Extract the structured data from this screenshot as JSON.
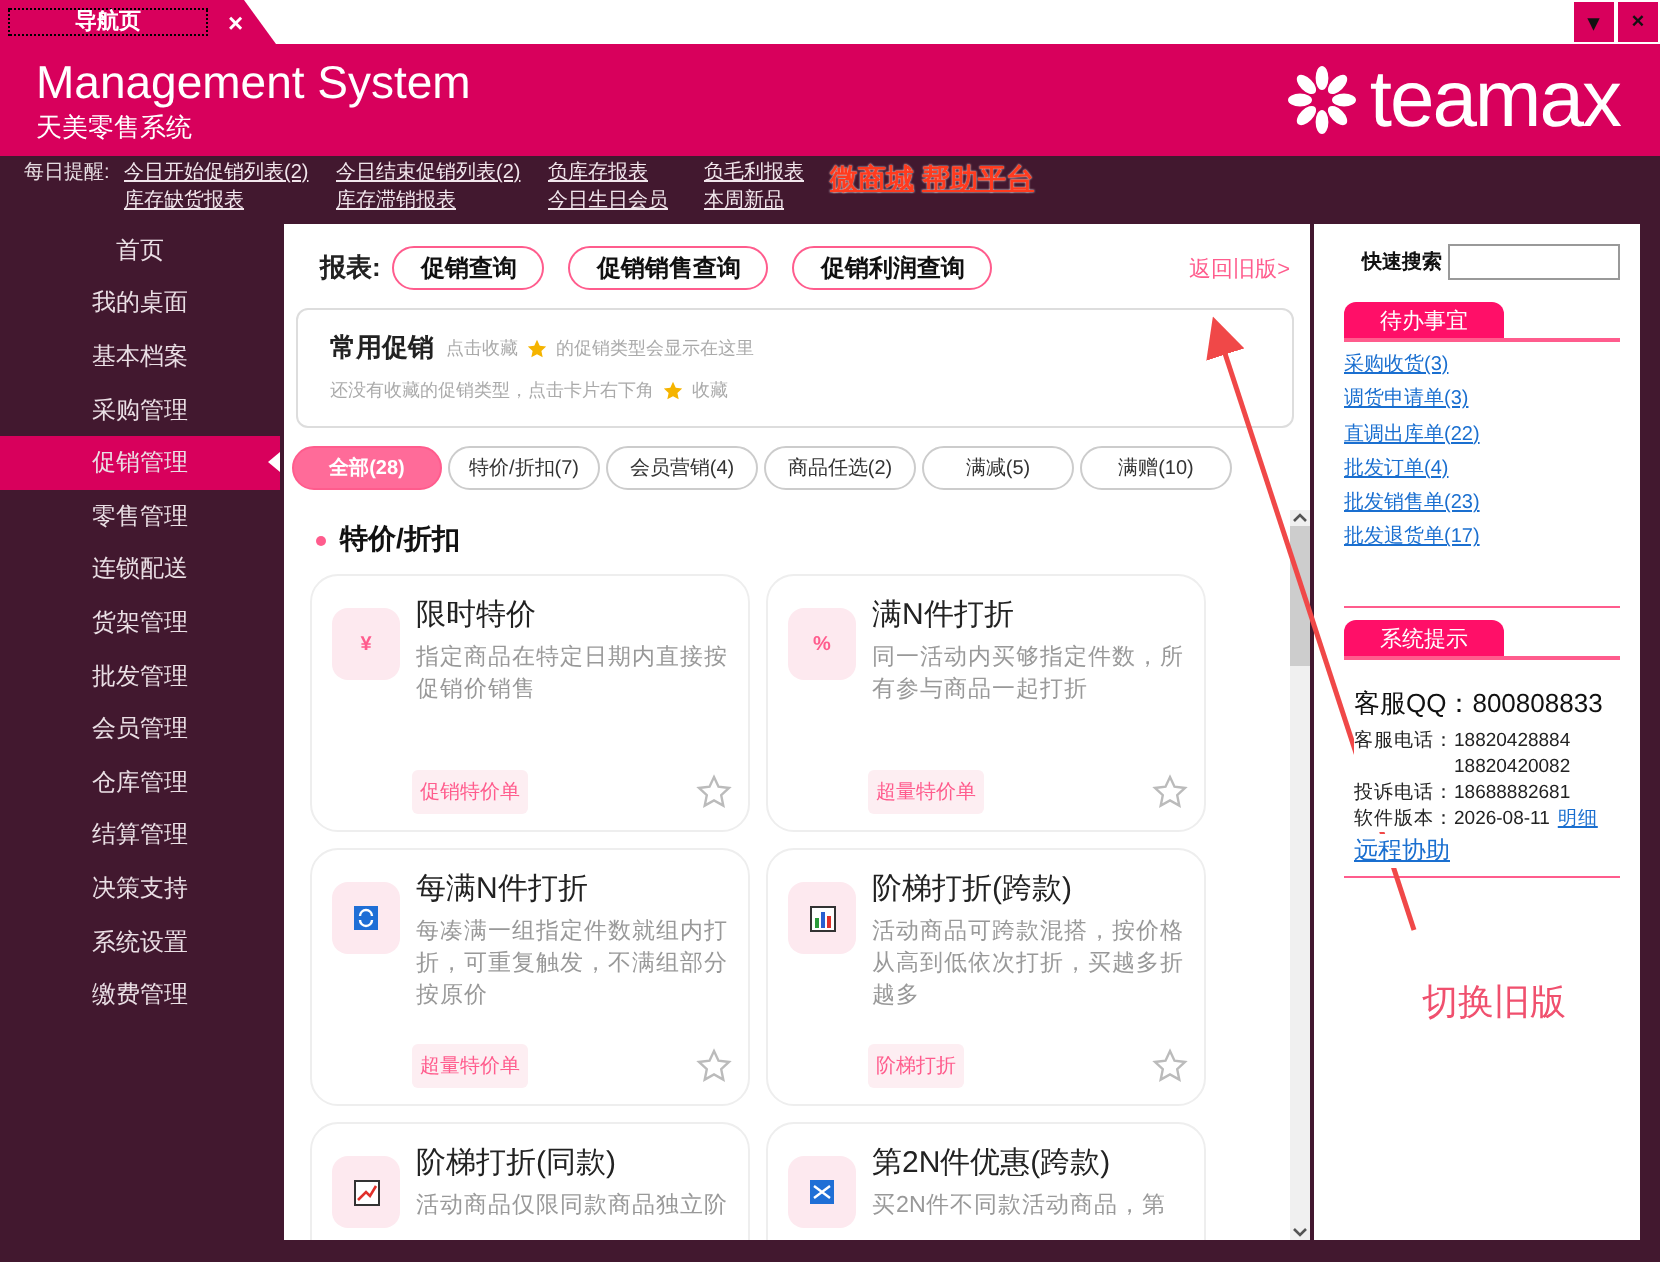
{
  "window": {
    "tab_title": "导航页",
    "tab_close": "×",
    "menu_button": "▾",
    "close_button": "×"
  },
  "header": {
    "title": "Management System",
    "subtitle": "天美零售系统",
    "logo_text": "teamax"
  },
  "reminders": {
    "label": "每日提醒:",
    "columns": [
      [
        "今日开始促销列表(2)",
        "库存缺货报表"
      ],
      [
        "今日结束促销列表(2)",
        "库存滞销报表"
      ],
      [
        "负库存报表",
        "今日生日会员"
      ],
      [
        "负毛利报表",
        "本周新品"
      ]
    ],
    "highlights": [
      "微商城",
      "帮助平台"
    ]
  },
  "sidebar": {
    "items": [
      {
        "label": "首页",
        "selected": false
      },
      {
        "label": "我的桌面",
        "selected": false
      },
      {
        "label": "基本档案",
        "selected": false
      },
      {
        "label": "采购管理",
        "selected": false
      },
      {
        "label": "促销管理",
        "selected": true
      },
      {
        "label": "零售管理",
        "selected": false
      },
      {
        "label": "连锁配送",
        "selected": false
      },
      {
        "label": "货架管理",
        "selected": false
      },
      {
        "label": "批发管理",
        "selected": false
      },
      {
        "label": "会员管理",
        "selected": false
      },
      {
        "label": "仓库管理",
        "selected": false
      },
      {
        "label": "结算管理",
        "selected": false
      },
      {
        "label": "决策支持",
        "selected": false
      },
      {
        "label": "系统设置",
        "selected": false
      },
      {
        "label": "缴费管理",
        "selected": false
      }
    ]
  },
  "reports": {
    "label": "报表:",
    "buttons": [
      "促销查询",
      "促销销售查询",
      "促销利润查询"
    ],
    "back_link": "返回旧版>"
  },
  "favorites": {
    "title": "常用促销",
    "hint_before": "点击收藏",
    "hint_after": "的促销类型会显示在这里",
    "empty_before": "还没有收藏的促销类型，点击卡片右下角",
    "empty_after": "收藏"
  },
  "filters": [
    {
      "label": "全部(28)",
      "selected": true
    },
    {
      "label": "特价/折扣(7)",
      "selected": false
    },
    {
      "label": "会员营销(4)",
      "selected": false
    },
    {
      "label": "商品任选(2)",
      "selected": false
    },
    {
      "label": "满减(5)",
      "selected": false
    },
    {
      "label": "满赠(10)",
      "selected": false
    }
  ],
  "section": {
    "title": "特价/折扣"
  },
  "cards": [
    {
      "icon": {
        "kind": "text",
        "text": "¥"
      },
      "title": "限时特价",
      "description": "指定商品在特定日期内直接按促销价销售",
      "tag": "促销特价单",
      "starred": false
    },
    {
      "icon": {
        "kind": "text",
        "text": "%"
      },
      "title": "满N件打折",
      "description": "同一活动内买够指定件数，所有参与商品一起打折",
      "tag": "超量特价单",
      "starred": false
    },
    {
      "icon": {
        "kind": "cycle"
      },
      "title": "每满N件打折",
      "description": "每凑满一组指定件数就组内打折，可重复触发，不满组部分按原价",
      "tag": "超量特价单",
      "starred": false
    },
    {
      "icon": {
        "kind": "bars"
      },
      "title": "阶梯打折(跨款)",
      "description": "活动商品可跨款混搭，按价格从高到低依次打折，买越多折越多",
      "tag": "阶梯打折",
      "starred": false
    },
    {
      "icon": {
        "kind": "trend"
      },
      "title": "阶梯打折(同款)",
      "description": "活动商品仅限同款商品独立阶"
    },
    {
      "icon": {
        "kind": "shuffle"
      },
      "title": "第2N件优惠(跨款)",
      "description": "买2N件不同款活动商品，第"
    }
  ],
  "todo": {
    "search_label": "快速搜索",
    "title": "待办事宜",
    "links": [
      "采购收货(3)",
      "调货申请单(3)",
      "直调出库单(22)",
      "批发订单(4)",
      "批发销售单(23)",
      "批发退货单(17)"
    ]
  },
  "system": {
    "title": "系统提示",
    "qq": "客服QQ：800808833",
    "phone_label": "客服电话：",
    "phones": [
      "18820428884",
      "18820420082"
    ],
    "complaint": "投诉电话：18688882681",
    "version": "软件版本：2026-08-11",
    "detail_link": "明细",
    "remote_link": "远程协助"
  },
  "annotation": {
    "text": "切换旧版"
  }
}
